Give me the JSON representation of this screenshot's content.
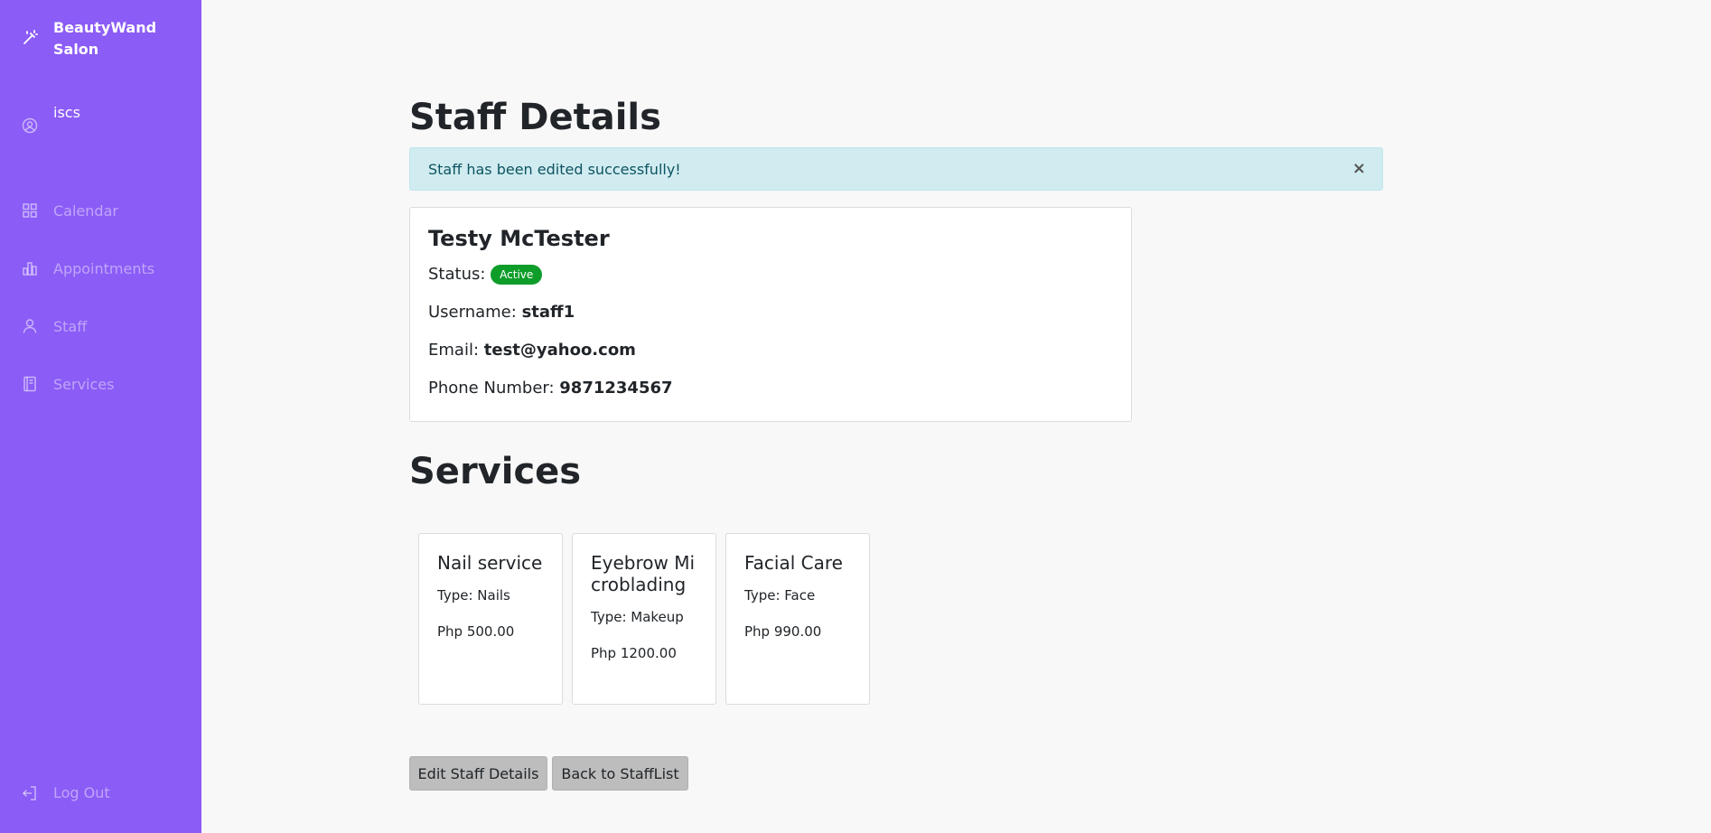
{
  "sidebar": {
    "brand": "BeautyWand Salon",
    "brand_icon": "magic-wand-icon",
    "user": "iscs",
    "nav": [
      {
        "label": "Calendar",
        "icon": "grid-icon"
      },
      {
        "label": "Appointments",
        "icon": "bar-chart-icon"
      },
      {
        "label": "Staff",
        "icon": "user-icon"
      },
      {
        "label": "Services",
        "icon": "book-icon"
      }
    ],
    "logout": "Log Out",
    "bg_color": "#8b5cf6"
  },
  "page": {
    "title": "Staff Details",
    "alert": {
      "message": "Staff has been edited successfully!",
      "close": "×"
    },
    "staff": {
      "name": "Testy McTester",
      "status_label": "Status:",
      "status": "Active",
      "username_label": "Username:",
      "username": "staff1",
      "email_label": "Email:",
      "email": "test@yahoo.com",
      "phone_label": "Phone Number:",
      "phone": "9871234567"
    },
    "services_title": "Services",
    "services": [
      {
        "name": "Nail service",
        "type": "Type: Nails",
        "price": "Php 500.00"
      },
      {
        "name": "Eyebrow Microblading",
        "type": "Type: Makeup",
        "price": "Php 1200.00"
      },
      {
        "name": "Facial Care",
        "type": "Type: Face",
        "price": "Php 990.00"
      }
    ],
    "buttons": {
      "edit": "Edit Staff Details",
      "back": "Back to StaffList"
    }
  }
}
